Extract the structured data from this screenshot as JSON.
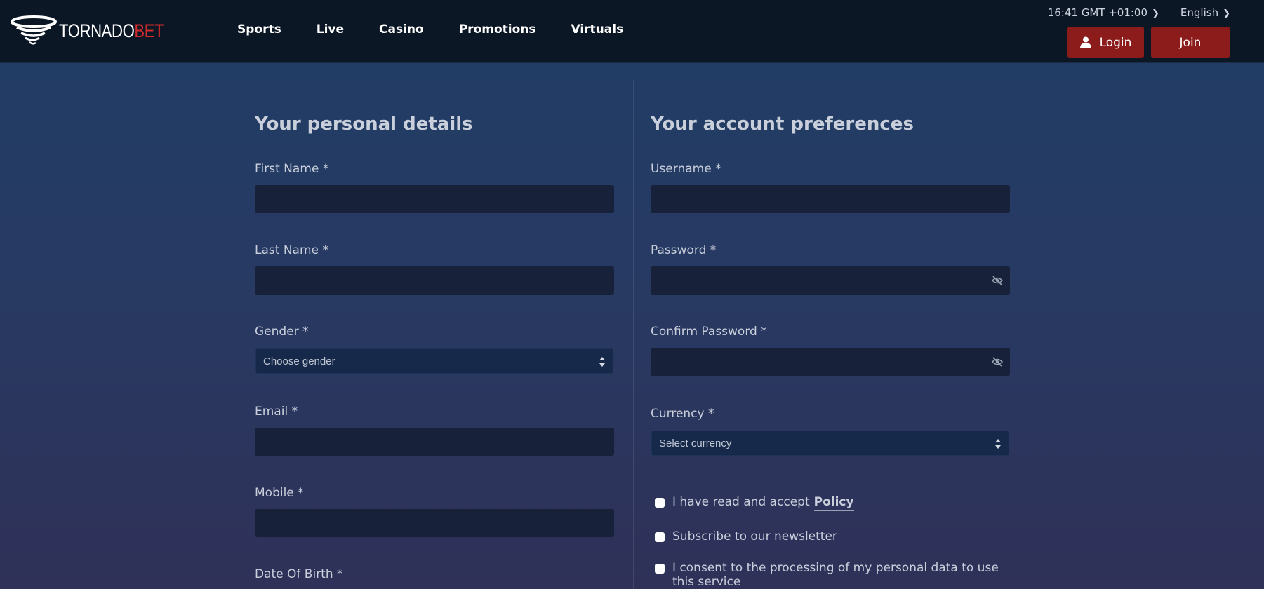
{
  "header": {
    "logo": {
      "part1": "TORNADO",
      "part2": "BET"
    },
    "nav": [
      "Sports",
      "Live",
      "Casino",
      "Promotions",
      "Virtuals"
    ],
    "time": "16:41 GMT +01:00",
    "language": "English",
    "login_label": "Login",
    "join_label": "Join"
  },
  "personal": {
    "title": "Your personal details",
    "first_name_label": "First Name *",
    "last_name_label": "Last Name *",
    "gender_label": "Gender *",
    "gender_value": "Choose gender",
    "email_label": "Email *",
    "mobile_label": "Mobile *",
    "dob_label": "Date Of Birth *"
  },
  "account": {
    "title": "Your account preferences",
    "username_label": "Username *",
    "password_label": "Password *",
    "confirm_password_label": "Confirm Password *",
    "currency_label": "Currency *",
    "currency_value": "Select currency",
    "policy_text": "I have read and accept",
    "policy_link": "Policy",
    "newsletter_text": "Subscribe to our newsletter",
    "consent_text": "I consent to the processing of my personal data to use this service"
  },
  "colors": {
    "header_bg": "#0c1726",
    "button_red": "#8c1c1c",
    "brand_red": "#d12b2b",
    "input_bg": "#17223a"
  }
}
